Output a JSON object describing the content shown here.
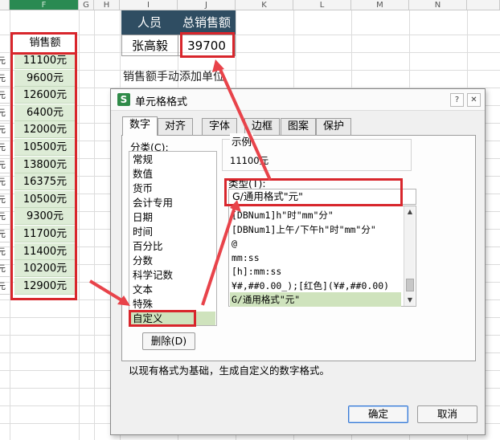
{
  "sheet": {
    "columns": [
      "F",
      "G",
      "H",
      "I",
      "J",
      "K",
      "L",
      "M",
      "N"
    ],
    "sales_header": "销售额",
    "sales_values": [
      "11100元",
      "9600元",
      "12600元",
      "6400元",
      "12000元",
      "10500元",
      "13800元",
      "16375元",
      "10500元",
      "9300元",
      "11700元",
      "11400元",
      "10200元",
      "12900元"
    ],
    "summary": {
      "headers": [
        "人员",
        "总销售额"
      ],
      "values": [
        "张高毅",
        "39700"
      ]
    },
    "note": "销售额手动添加单位",
    "header_color": "#2f4d62",
    "cell_fill": "#ddecd6",
    "highlight_color": "#d8262c"
  },
  "dialog": {
    "title": "单元格格式",
    "app_icon": "S",
    "tabs": [
      "数字",
      "对齐",
      "字体",
      "边框",
      "图案",
      "保护"
    ],
    "active_tab": "数字",
    "category_label": "分类(C):",
    "categories": [
      "常规",
      "数值",
      "货币",
      "会计专用",
      "日期",
      "时间",
      "百分比",
      "分数",
      "科学记数",
      "文本",
      "特殊",
      "自定义"
    ],
    "selected_category": "自定义",
    "sample_label": "示例",
    "sample_value": "11100元",
    "type_label": "类型(T):",
    "type_value": "G/通用格式\"元\"",
    "format_list": [
      "[DBNum1]h\"时\"mm\"分\"",
      "[DBNum1]上午/下午h\"时\"mm\"分\"",
      "@",
      "mm:ss",
      "[h]:mm:ss",
      "¥#,##0.00_);[红色](¥#,##0.00)",
      "G/通用格式\"元\""
    ],
    "delete_button": "删除(D)",
    "description": "以现有格式为基础，生成自定义的数字格式。",
    "ok_button": "确定",
    "cancel_button": "取消",
    "close_icon": "close-icon",
    "help_icon": "help-icon"
  }
}
